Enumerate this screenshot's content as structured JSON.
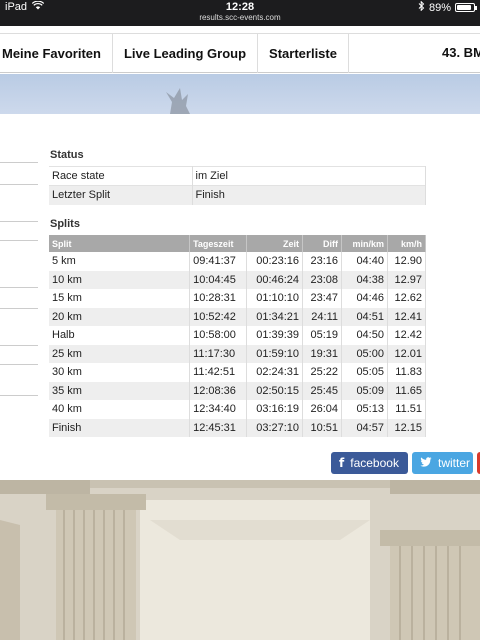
{
  "statusbar": {
    "device": "iPad",
    "time": "12:28",
    "url": "results.scc-events.com",
    "battery": "89%",
    "battery_level": 0.89
  },
  "nav": {
    "items": [
      "Meine Favoriten",
      "Live Leading Group",
      "Starterliste"
    ],
    "title": "43. BM"
  },
  "status": {
    "title": "Status",
    "rows": [
      {
        "label": "Race state",
        "value": "im Ziel"
      },
      {
        "label": "Letzter Split",
        "value": "Finish"
      }
    ]
  },
  "splits": {
    "title": "Splits",
    "headers": {
      "split": "Split",
      "tageszeit": "Tageszeit",
      "zeit": "Zeit",
      "diff": "Diff",
      "min_km": "min/km",
      "kmh": "km/h"
    },
    "rows": [
      {
        "split": "5 km",
        "tageszeit": "09:41:37",
        "zeit": "00:23:16",
        "diff": "23:16",
        "min_km": "04:40",
        "kmh": "12.90"
      },
      {
        "split": "10 km",
        "tageszeit": "10:04:45",
        "zeit": "00:46:24",
        "diff": "23:08",
        "min_km": "04:38",
        "kmh": "12.97"
      },
      {
        "split": "15 km",
        "tageszeit": "10:28:31",
        "zeit": "01:10:10",
        "diff": "23:47",
        "min_km": "04:46",
        "kmh": "12.62"
      },
      {
        "split": "20 km",
        "tageszeit": "10:52:42",
        "zeit": "01:34:21",
        "diff": "24:11",
        "min_km": "04:51",
        "kmh": "12.41"
      },
      {
        "split": "Halb",
        "tageszeit": "10:58:00",
        "zeit": "01:39:39",
        "diff": "05:19",
        "min_km": "04:50",
        "kmh": "12.42"
      },
      {
        "split": "25 km",
        "tageszeit": "11:17:30",
        "zeit": "01:59:10",
        "diff": "19:31",
        "min_km": "05:00",
        "kmh": "12.01"
      },
      {
        "split": "30 km",
        "tageszeit": "11:42:51",
        "zeit": "02:24:31",
        "diff": "25:22",
        "min_km": "05:05",
        "kmh": "11.83"
      },
      {
        "split": "35 km",
        "tageszeit": "12:08:36",
        "zeit": "02:50:15",
        "diff": "25:45",
        "min_km": "05:09",
        "kmh": "11.65"
      },
      {
        "split": "40 km",
        "tageszeit": "12:34:40",
        "zeit": "03:16:19",
        "diff": "26:04",
        "min_km": "05:13",
        "kmh": "11.51"
      },
      {
        "split": "Finish",
        "tageszeit": "12:45:31",
        "zeit": "03:27:10",
        "diff": "10:51",
        "min_km": "04:57",
        "kmh": "12.15"
      }
    ]
  },
  "share": {
    "facebook": "facebook",
    "twitter": "twitter"
  }
}
